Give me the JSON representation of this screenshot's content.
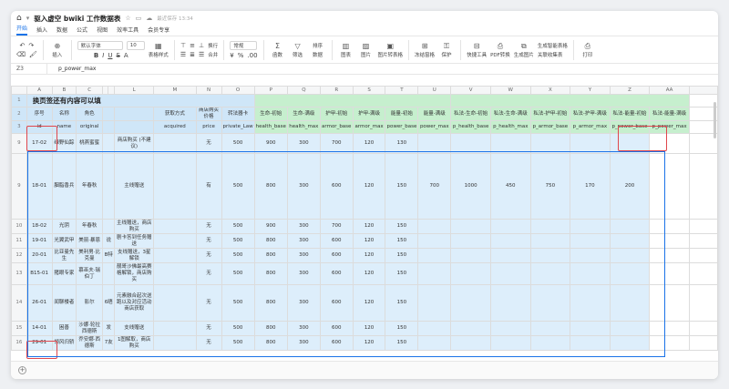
{
  "titlebar": {
    "title": "驱入虚空 bwiki 工作数据表",
    "saved": "最近保存 13:34"
  },
  "menu": [
    "开始",
    "插入",
    "数据",
    "公式",
    "视图",
    "效率工具",
    "会员专享"
  ],
  "ribbon": {
    "insert": "插入",
    "font": "默认字体",
    "size": "10",
    "format_table": "表格样式",
    "wrap": "换行",
    "merge": "合并",
    "general": "常规",
    "sum": "函数",
    "filter": "筛选",
    "sort": "排序",
    "data": "数据",
    "chart": "图表",
    "image": "图片",
    "img_convert": "图片转表格",
    "freeze": "冻结窗格",
    "protect": "保护",
    "quick": "快捷工具",
    "pdf": "PDF转换",
    "gen_img": "生成图片",
    "smart": "生成智能表格",
    "collect": "关联收集表",
    "print": "打印"
  },
  "formula": {
    "ref": "Z3",
    "value": "p_power_max"
  },
  "columns": [
    "A",
    "B",
    "C",
    "L",
    "M",
    "N",
    "O",
    "P",
    "Q",
    "R",
    "S",
    "T",
    "U",
    "V",
    "W",
    "X",
    "Y",
    "Z",
    "AA"
  ],
  "row1": {
    "num": "1",
    "title": "换页签还有内容可以填"
  },
  "row2": {
    "num": "2",
    "cells": [
      "序号",
      "名称",
      "角色",
      "获取方式",
      "商店购买价格",
      "转法器卡",
      "生命-初始",
      "生命-满级",
      "护甲-初始",
      "护甲-满级",
      "能量-初始",
      "能量-满级",
      "私法-生命-初始",
      "私法-生命-满级",
      "私法-护甲-初始",
      "私法-护甲-满级",
      "私法-能量-初始",
      "私法-能量-满级"
    ]
  },
  "row3": {
    "num": "3",
    "cells": [
      "id",
      "name",
      "original",
      "acquired",
      "price",
      "private_Law",
      "health_base",
      "health_max",
      "armor_base",
      "armor_max",
      "power_base",
      "power_max",
      "p_health_base",
      "p_health_max",
      "p_armor_base",
      "p_armor_max",
      "p_power_base",
      "p_power_max"
    ]
  },
  "rows": [
    {
      "num": "9",
      "cells": [
        "17-02",
        "绿野仙踪",
        "桃燕蜜蜜",
        "",
        "商店购买 (不建议)",
        "",
        "无",
        "500",
        "900",
        "300",
        "700",
        "120",
        "130",
        "",
        "",
        "",
        "",
        "",
        ""
      ]
    },
    {
      "num": "9",
      "cells": [
        "18-01",
        "胭脂香兵",
        "年春秋",
        "",
        "主线赠送",
        "",
        "有",
        "500",
        "800",
        "300",
        "600",
        "120",
        "150",
        "700",
        "1000",
        "450",
        "750",
        "170",
        "200"
      ]
    },
    {
      "num": "10",
      "cells": [
        "18-02",
        "光阴",
        "年春秋",
        "",
        "主线赠送，商店购买",
        "",
        "无",
        "500",
        "900",
        "300",
        "700",
        "120",
        "150",
        "",
        "",
        "",
        "",
        "",
        ""
      ]
    },
    {
      "num": "11",
      "cells": [
        "19-01",
        "光翼武甲",
        "美丽·暴恩",
        "说",
        "剧卡答到任务赠送",
        "",
        "无",
        "500",
        "800",
        "300",
        "600",
        "120",
        "150",
        "",
        "",
        "",
        "",
        "",
        ""
      ]
    },
    {
      "num": "12",
      "cells": [
        "20-01",
        "比亚曼先生",
        "美利男·比克曼",
        "B特",
        "支线赠送，3星解锁",
        "",
        "无",
        "500",
        "800",
        "300",
        "600",
        "120",
        "150",
        "",
        "",
        "",
        "",
        "",
        ""
      ]
    },
    {
      "num": "13",
      "cells": [
        "B15-01",
        "猪眼专家",
        "慕巫夫·瑞伯丁",
        "",
        "靓哥沙佛最高赛格解锁，商店购买",
        "",
        "无",
        "500",
        "800",
        "300",
        "600",
        "120",
        "150",
        "",
        "",
        "",
        "",
        "",
        ""
      ]
    },
    {
      "num": "14",
      "cells": [
        "26-01",
        "闻聊楼者",
        "影尔",
        "6晤",
        "元素融合起次送跑以及对应活动商店获取",
        "",
        "无",
        "500",
        "800",
        "300",
        "600",
        "120",
        "150",
        "",
        "",
        "",
        "",
        "",
        ""
      ]
    },
    {
      "num": "15",
      "cells": [
        "14-01",
        "困善",
        "沙娜·轮拉西德斯",
        "发",
        "支线赠送",
        "",
        "无",
        "500",
        "800",
        "300",
        "600",
        "120",
        "150",
        "",
        "",
        "",
        "",
        "",
        ""
      ]
    },
    {
      "num": "16",
      "cells": [
        "29-01",
        "领风归轿",
        "乔安娜·西德斯",
        "7友",
        "1图解取，商店购买",
        "",
        "无",
        "500",
        "800",
        "300",
        "600",
        "120",
        "150",
        "",
        "",
        "",
        "",
        "",
        ""
      ]
    }
  ]
}
